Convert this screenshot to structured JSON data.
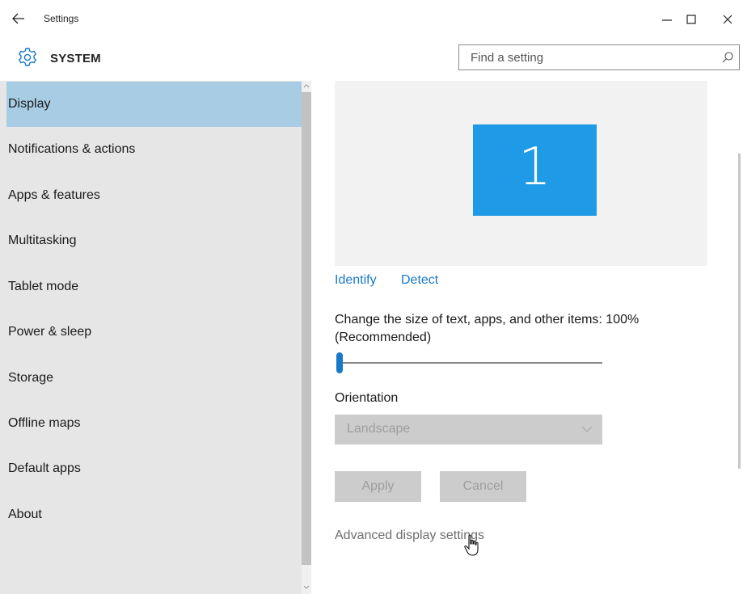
{
  "titlebar": {
    "back_icon": "back-arrow-icon",
    "title": "Settings",
    "minimize_icon": "minimize-icon",
    "maximize_icon": "maximize-icon",
    "close_icon": "close-icon"
  },
  "header": {
    "section_icon": "gear-icon",
    "section_title": "SYSTEM",
    "search": {
      "placeholder": "Find a setting",
      "value": "",
      "icon": "search-icon"
    }
  },
  "sidebar": {
    "items": [
      {
        "label": "Display",
        "selected": true
      },
      {
        "label": "Notifications & actions",
        "selected": false
      },
      {
        "label": "Apps & features",
        "selected": false
      },
      {
        "label": "Multitasking",
        "selected": false
      },
      {
        "label": "Tablet mode",
        "selected": false
      },
      {
        "label": "Power & sleep",
        "selected": false
      },
      {
        "label": "Storage",
        "selected": false
      },
      {
        "label": "Offline maps",
        "selected": false
      },
      {
        "label": "Default apps",
        "selected": false
      },
      {
        "label": "About",
        "selected": false
      }
    ]
  },
  "display": {
    "monitor_number": "1",
    "identify_label": "Identify",
    "detect_label": "Detect",
    "scale_label": "Change the size of text, apps, and other items: 100% (Recommended)",
    "scale_value_percent": 100,
    "orientation_label": "Orientation",
    "orientation_value": "Landscape",
    "apply_label": "Apply",
    "cancel_label": "Cancel",
    "advanced_link": "Advanced display settings"
  },
  "colors": {
    "accent": "#1979c9",
    "selected_nav": "#a8cce4",
    "monitor_tile": "#1e9ae6",
    "sidebar_bg": "#e6e6e6"
  }
}
